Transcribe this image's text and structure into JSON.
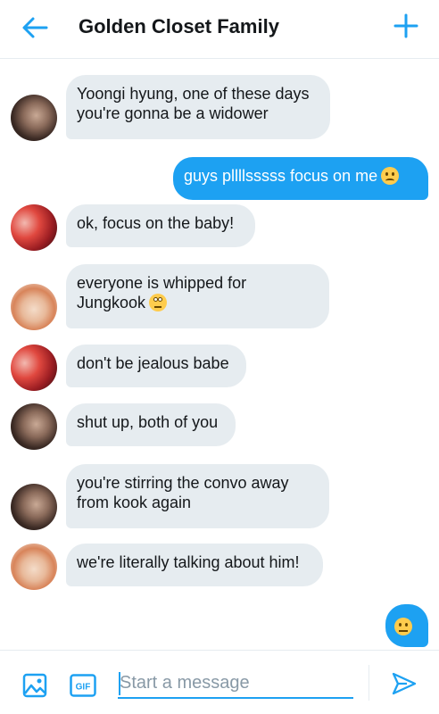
{
  "header": {
    "title": "Golden Closet Family",
    "back_icon": "arrow-left-icon",
    "new_icon": "plus-icon",
    "accent": "#1da1f2"
  },
  "messages": [
    {
      "side": "in",
      "avatar": "avatar-a",
      "text": "Yoongi hyung, one of these days you're gonna be a widower"
    },
    {
      "side": "out",
      "text": "guys pllllsssss focus on me",
      "emoji": "frowning-face"
    },
    {
      "side": "in",
      "avatar": "avatar-b",
      "text": "ok, focus on the baby!"
    },
    {
      "side": "in",
      "avatar": "avatar-c",
      "text": "everyone is whipped for Jungkook",
      "emoji": "face-with-rolling-eyes"
    },
    {
      "side": "in",
      "avatar": "avatar-b",
      "text": "don't be jealous babe"
    },
    {
      "side": "in",
      "avatar": "avatar-a",
      "text": "shut up, both of you"
    },
    {
      "side": "in",
      "avatar": "avatar-a",
      "text": "you're stirring the convo away from kook again"
    },
    {
      "side": "in",
      "avatar": "avatar-c",
      "text": "we're literally talking about him!"
    },
    {
      "side": "out",
      "text": "",
      "emoji": "pensive-face"
    }
  ],
  "composer": {
    "placeholder": "Start a message",
    "image_icon": "image-icon",
    "gif_label": "GIF",
    "send_icon": "send-icon"
  },
  "colors": {
    "incoming_bubble": "#e6ecf0",
    "outgoing_bubble": "#1da1f2"
  }
}
